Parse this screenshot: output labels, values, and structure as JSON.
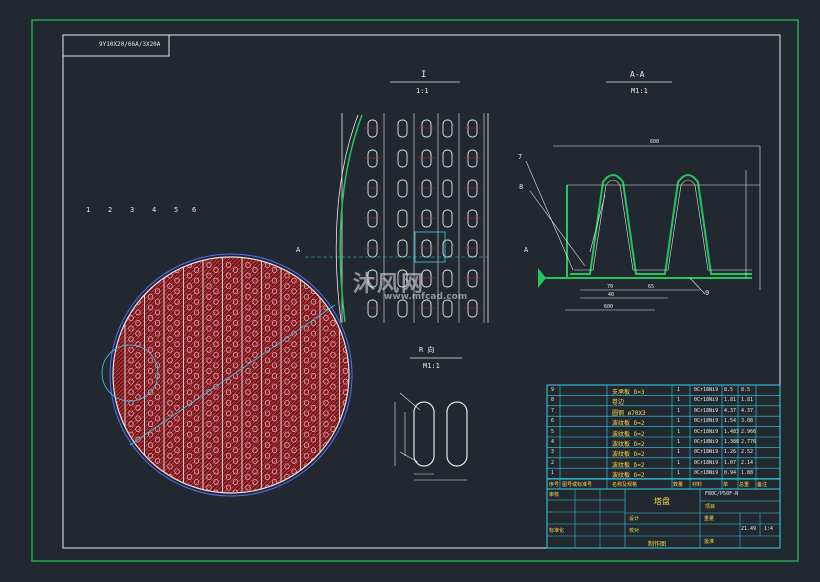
{
  "title_block_code": "9Y10X20/66A/3X20A",
  "detail_i": {
    "label": "I",
    "scale": "1:1"
  },
  "section_aa": {
    "label": "A-A",
    "scale": "M1:1"
  },
  "section_marks": {
    "left": "A",
    "right": "A"
  },
  "detail_r": {
    "label": "R 向",
    "scale": "M1:1"
  },
  "callouts_plan": [
    "1",
    "2",
    "3",
    "4",
    "5",
    "6"
  ],
  "callouts_section": [
    "7",
    "8",
    "9"
  ],
  "dimensions": {
    "section_top": "600",
    "pitch_a": "70",
    "pitch_b": "65",
    "spacing": "40",
    "width": "600"
  },
  "watermark": {
    "brand": "沐风网",
    "url": "www.mfcad.com"
  },
  "bom": {
    "rows": [
      [
        "9",
        "支承板 δ=3",
        "1",
        "0Cr18Ni9",
        "8.5",
        "8.5"
      ],
      [
        "8",
        "卷边",
        "1",
        "0Cr18Ni9",
        "1.81",
        "1.81"
      ],
      [
        "7",
        "圆钢 ø70X3",
        "1",
        "0Cr18Ni9",
        "4.37",
        "4.37"
      ],
      [
        "6",
        "波纹板 δ=2",
        "1",
        "0Cr18Ni9",
        "1.54",
        "3.08"
      ],
      [
        "5",
        "波纹板 δ=2",
        "1",
        "0Cr18Ni9",
        "1.483",
        "2.966"
      ],
      [
        "4",
        "波纹板 δ=2",
        "1",
        "0Cr18Ni9",
        "1.388",
        "2.776"
      ],
      [
        "3",
        "波纹板 δ=2",
        "1",
        "0Cr18Ni9",
        "1.26",
        "2.52"
      ],
      [
        "2",
        "波纹板 δ=2",
        "1",
        "0Cr18Ni9",
        "1.07",
        "2.14"
      ],
      [
        "1",
        "波纹板 δ=2",
        "1",
        "0Cr18Ni9",
        "0.94",
        "1.88"
      ]
    ],
    "header": [
      "序号",
      "图号或标准号",
      "名称及规格",
      "数量",
      "材料",
      "单",
      "总重",
      "备注"
    ]
  },
  "title_block": {
    "drawing_name": "塔盘",
    "code": "F80C/P50F-N",
    "material_label": "项目",
    "project": "图号",
    "weight_label": "重量",
    "weight": "21.49",
    "scale": "1:4",
    "designer_label": "设计",
    "checker_label": "校对",
    "review_label": "审核",
    "standard_label": "标准化",
    "approve_label": "批准",
    "title_bottom": "制作图"
  },
  "colors": {
    "bg": "#212830",
    "frame": "#22c65c",
    "line": "#e6e6e6",
    "hatch": "#c8202a",
    "hole": "#e8a8b8",
    "accent": "#ffffff",
    "cyan": "#35d0e8",
    "blue": "#5a6cff",
    "yellow": "#ffd84a"
  }
}
